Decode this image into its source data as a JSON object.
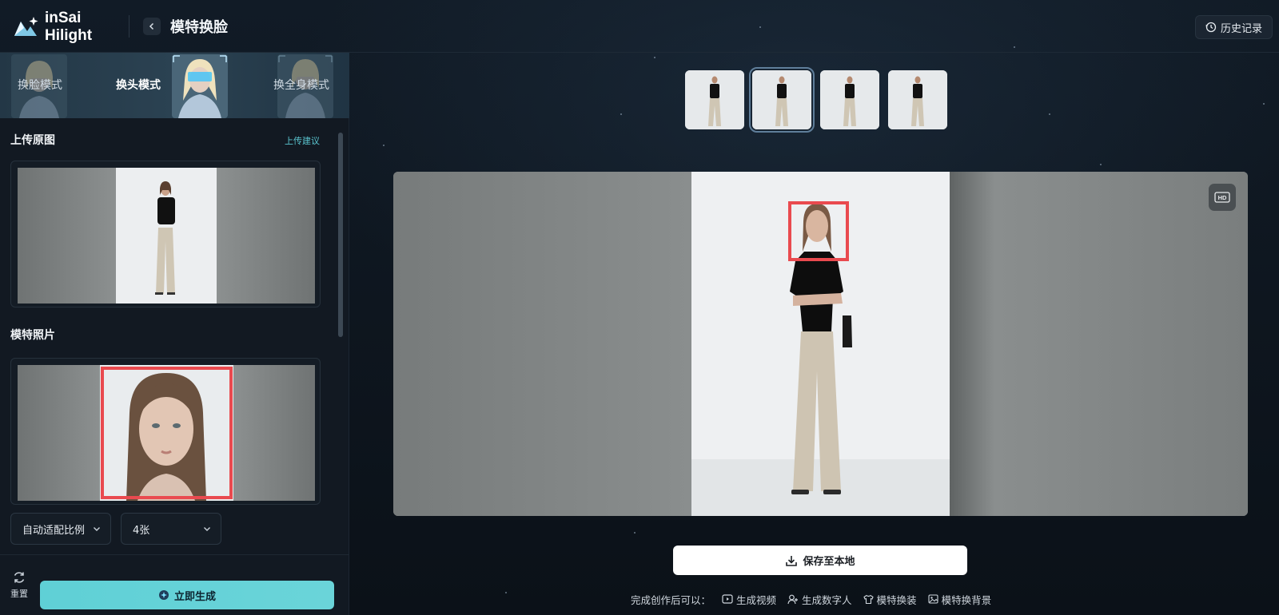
{
  "app": {
    "brand": "inSai Hilight",
    "title": "模特换脸",
    "history_label": "历史记录"
  },
  "modes": [
    {
      "label": "换脸模式",
      "active": false
    },
    {
      "label": "换头模式",
      "active": true
    },
    {
      "label": "换全身模式",
      "active": false
    }
  ],
  "upload": {
    "title": "上传原图",
    "hint": "上传建议"
  },
  "model_photo": {
    "title": "模特照片"
  },
  "options": {
    "ratio": "自动适配比例",
    "count": "4张"
  },
  "actions": {
    "reset_label": "重置",
    "generate_label": "立即生成",
    "save_label": "保存至本地"
  },
  "after": {
    "prefix": "完成创作后可以：",
    "items": [
      {
        "label": "生成视频",
        "icon": "video-icon"
      },
      {
        "label": "生成数字人",
        "icon": "person-add-icon"
      },
      {
        "label": "模特换装",
        "icon": "shirt-icon"
      },
      {
        "label": "模特换背景",
        "icon": "image-icon"
      }
    ]
  },
  "results": {
    "count": 4,
    "selected_index": 1
  },
  "stage": {
    "hd_label": "HD"
  },
  "colors": {
    "accent": "#5fd0d6",
    "highlight_box": "#e94a4f",
    "background": "#0c131c"
  }
}
